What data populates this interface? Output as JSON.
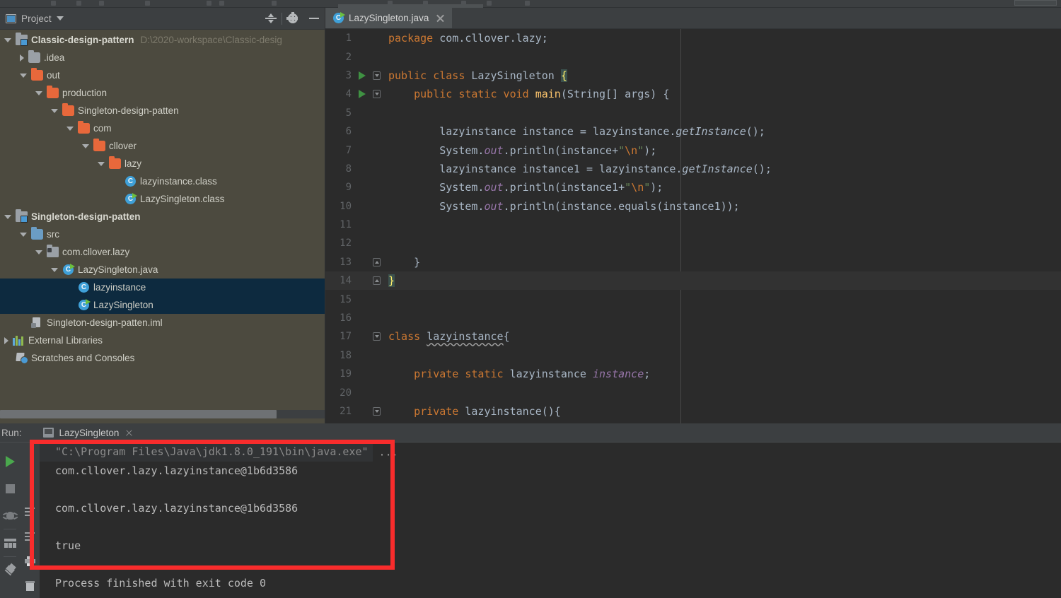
{
  "window": {
    "theme": "IntelliJ IDEA Darcula",
    "colors": {
      "editor_bg": "#2b2b2b",
      "panel_bg": "#3c3f41",
      "project_bg": "#4c4a3f",
      "selection": "#0d2a3f",
      "keyword": "#cc7832",
      "string": "#6a8759",
      "field": "#9876aa",
      "method": "#ffc66d",
      "default_text": "#a9b7c6",
      "annotation_red": "#f82c2c"
    }
  },
  "project_panel": {
    "title": "Project",
    "icons": {
      "panel_icon": "project-window-icon",
      "dropdown": "chevron-down-icon",
      "collapse_all": "collapse-all-icon",
      "settings": "gear-icon",
      "hide": "minimize-icon"
    },
    "tree": [
      {
        "id": "classic-design-pattern",
        "label": "Classic-design-pattern",
        "path": "D:\\2020-workspace\\Classic-desig",
        "depth": 0,
        "arrow": "open",
        "icon": "module-icon",
        "bold": true,
        "selected": false
      },
      {
        "id": "idea",
        "label": ".idea",
        "path": "",
        "depth": 1,
        "arrow": "closed",
        "icon": "folder-gray-icon",
        "bold": false,
        "selected": false
      },
      {
        "id": "out",
        "label": "out",
        "path": "",
        "depth": 1,
        "arrow": "open",
        "icon": "folder-orange-icon",
        "bold": false,
        "selected": false
      },
      {
        "id": "production",
        "label": "production",
        "path": "",
        "depth": 2,
        "arrow": "open",
        "icon": "folder-orange-icon",
        "bold": false,
        "selected": false
      },
      {
        "id": "singleton-design-patten-out",
        "label": "Singleton-design-patten",
        "path": "",
        "depth": 3,
        "arrow": "open",
        "icon": "folder-orange-icon",
        "bold": false,
        "selected": false
      },
      {
        "id": "com",
        "label": "com",
        "path": "",
        "depth": 4,
        "arrow": "open",
        "icon": "folder-orange-icon",
        "bold": false,
        "selected": false
      },
      {
        "id": "cllover",
        "label": "cllover",
        "path": "",
        "depth": 5,
        "arrow": "open",
        "icon": "folder-orange-icon",
        "bold": false,
        "selected": false
      },
      {
        "id": "lazy",
        "label": "lazy",
        "path": "",
        "depth": 6,
        "arrow": "open",
        "icon": "folder-orange-icon",
        "bold": false,
        "selected": false
      },
      {
        "id": "lazyinstance-class",
        "label": "lazyinstance.class",
        "path": "",
        "depth": 7,
        "arrow": "none",
        "icon": "java-class-icon",
        "bold": false,
        "selected": false
      },
      {
        "id": "lazysingleton-class",
        "label": "LazySingleton.class",
        "path": "",
        "depth": 7,
        "arrow": "none",
        "icon": "java-class-runnable-icon",
        "bold": false,
        "selected": false
      },
      {
        "id": "singleton-design-patten",
        "label": "Singleton-design-patten",
        "path": "",
        "depth": 0,
        "arrow": "open",
        "icon": "module-icon",
        "bold": true,
        "selected": false
      },
      {
        "id": "src",
        "label": "src",
        "path": "",
        "depth": 1,
        "arrow": "open",
        "icon": "folder-blue-icon",
        "bold": false,
        "selected": false
      },
      {
        "id": "com-cllover-lazy",
        "label": "com.cllover.lazy",
        "path": "",
        "depth": 2,
        "arrow": "open",
        "icon": "package-icon",
        "bold": false,
        "selected": false
      },
      {
        "id": "lazysingleton-java",
        "label": "LazySingleton.java",
        "path": "",
        "depth": 3,
        "arrow": "open",
        "icon": "java-class-runnable-icon",
        "bold": false,
        "selected": false
      },
      {
        "id": "lazyinstance-node",
        "label": "lazyinstance",
        "path": "",
        "depth": 4,
        "arrow": "none",
        "icon": "java-class-icon",
        "bold": false,
        "selected": true
      },
      {
        "id": "lazysingleton-node",
        "label": "LazySingleton",
        "path": "",
        "depth": 4,
        "arrow": "none",
        "icon": "java-class-runnable-icon",
        "bold": false,
        "selected": true
      },
      {
        "id": "iml",
        "label": "Singleton-design-patten.iml",
        "path": "",
        "depth": 1,
        "arrow": "none",
        "icon": "iml-file-icon",
        "bold": false,
        "selected": false
      },
      {
        "id": "external-libraries",
        "label": "External Libraries",
        "path": "",
        "depth": 0,
        "arrow": "closed",
        "icon": "libraries-icon",
        "bold": false,
        "selected": false
      },
      {
        "id": "scratches",
        "label": "Scratches and Consoles",
        "path": "",
        "depth": 0,
        "arrow": "none",
        "icon": "scratches-icon",
        "bold": false,
        "selected": false
      }
    ]
  },
  "editor": {
    "tab": {
      "name": "LazySingleton.java",
      "icon": "java-class-runnable-icon",
      "close": "close-icon",
      "active": true
    },
    "caret_line": 14,
    "lines": [
      {
        "n": 1,
        "run": false,
        "fold": "",
        "indent": 0,
        "tokens": [
          {
            "t": "package",
            "c": "kw"
          },
          {
            "t": " com.cllover.lazy;",
            "c": ""
          }
        ]
      },
      {
        "n": 2,
        "run": false,
        "fold": "",
        "indent": 0,
        "tokens": []
      },
      {
        "n": 3,
        "run": true,
        "fold": "start",
        "indent": 0,
        "tokens": [
          {
            "t": "public class",
            "c": "kw"
          },
          {
            "t": " LazySingleton ",
            "c": ""
          },
          {
            "t": "{",
            "c": "brace"
          }
        ]
      },
      {
        "n": 4,
        "run": true,
        "fold": "start",
        "indent": 1,
        "tokens": [
          {
            "t": "public static void",
            "c": "kw"
          },
          {
            "t": " ",
            "c": ""
          },
          {
            "t": "main",
            "c": "fn"
          },
          {
            "t": "(String[] args) {",
            "c": ""
          }
        ]
      },
      {
        "n": 5,
        "run": false,
        "fold": "",
        "indent": 1,
        "tokens": []
      },
      {
        "n": 6,
        "run": false,
        "fold": "",
        "indent": 2,
        "tokens": [
          {
            "t": "lazyinstance instance = lazyinstance.",
            "c": ""
          },
          {
            "t": "getInstance",
            "c": "it"
          },
          {
            "t": "();",
            "c": ""
          }
        ]
      },
      {
        "n": 7,
        "run": false,
        "fold": "",
        "indent": 2,
        "tokens": [
          {
            "t": "System.",
            "c": ""
          },
          {
            "t": "out",
            "c": "fld"
          },
          {
            "t": ".println(instance+",
            "c": ""
          },
          {
            "t": "\"",
            "c": "str"
          },
          {
            "t": "\\n",
            "c": "esc"
          },
          {
            "t": "\"",
            "c": "str"
          },
          {
            "t": ");",
            "c": ""
          }
        ]
      },
      {
        "n": 8,
        "run": false,
        "fold": "",
        "indent": 2,
        "tokens": [
          {
            "t": "lazyinstance instance1 = lazyinstance.",
            "c": ""
          },
          {
            "t": "getInstance",
            "c": "it"
          },
          {
            "t": "();",
            "c": ""
          }
        ]
      },
      {
        "n": 9,
        "run": false,
        "fold": "",
        "indent": 2,
        "tokens": [
          {
            "t": "System.",
            "c": ""
          },
          {
            "t": "out",
            "c": "fld"
          },
          {
            "t": ".println(instance1+",
            "c": ""
          },
          {
            "t": "\"",
            "c": "str"
          },
          {
            "t": "\\n",
            "c": "esc"
          },
          {
            "t": "\"",
            "c": "str"
          },
          {
            "t": ");",
            "c": ""
          }
        ]
      },
      {
        "n": 10,
        "run": false,
        "fold": "",
        "indent": 2,
        "tokens": [
          {
            "t": "System.",
            "c": ""
          },
          {
            "t": "out",
            "c": "fld"
          },
          {
            "t": ".println(instance.equals(instance1));",
            "c": ""
          }
        ]
      },
      {
        "n": 11,
        "run": false,
        "fold": "",
        "indent": 0,
        "tokens": []
      },
      {
        "n": 12,
        "run": false,
        "fold": "",
        "indent": 0,
        "tokens": []
      },
      {
        "n": 13,
        "run": false,
        "fold": "end",
        "indent": 1,
        "tokens": [
          {
            "t": "}",
            "c": ""
          }
        ]
      },
      {
        "n": 14,
        "run": false,
        "fold": "end",
        "indent": 0,
        "tokens": [
          {
            "t": "}",
            "c": "brace"
          }
        ]
      },
      {
        "n": 15,
        "run": false,
        "fold": "",
        "indent": 0,
        "tokens": []
      },
      {
        "n": 16,
        "run": false,
        "fold": "",
        "indent": 0,
        "tokens": []
      },
      {
        "n": 17,
        "run": false,
        "fold": "start",
        "indent": 0,
        "tokens": [
          {
            "t": "class",
            "c": "kw"
          },
          {
            "t": " ",
            "c": ""
          },
          {
            "t": "lazyinstance",
            "c": "sq"
          },
          {
            "t": "{",
            "c": ""
          }
        ]
      },
      {
        "n": 18,
        "run": false,
        "fold": "",
        "indent": 0,
        "tokens": []
      },
      {
        "n": 19,
        "run": false,
        "fold": "",
        "indent": 1,
        "tokens": [
          {
            "t": "private static",
            "c": "kw"
          },
          {
            "t": " lazyinstance ",
            "c": ""
          },
          {
            "t": "instance",
            "c": "fld"
          },
          {
            "t": ";",
            "c": ""
          }
        ]
      },
      {
        "n": 20,
        "run": false,
        "fold": "",
        "indent": 0,
        "tokens": []
      },
      {
        "n": 21,
        "run": false,
        "fold": "start",
        "indent": 1,
        "tokens": [
          {
            "t": "private",
            "c": "kw"
          },
          {
            "t": " lazyinstance(){",
            "c": ""
          }
        ]
      }
    ]
  },
  "run_panel": {
    "label": "Run:",
    "tab": {
      "name": "LazySingleton",
      "icon": "run-config-icon",
      "close": "close-icon"
    },
    "toolbar": [
      {
        "id": "rerun",
        "name": "rerun-button",
        "icon": "play-icon"
      },
      {
        "id": "stop",
        "name": "stop-button",
        "icon": "stop-icon"
      },
      {
        "id": "debug",
        "name": "debug-button",
        "icon": "bug-icon"
      },
      {
        "id": "layout",
        "name": "restore-layout-button",
        "icon": "grid-icon"
      },
      {
        "id": "pin",
        "name": "pin-tab-button",
        "icon": "pin-icon"
      }
    ],
    "toolbar2": [
      {
        "id": "soft-wrap",
        "name": "soft-wrap-button",
        "icon": "lines-icon"
      },
      {
        "id": "scroll-end",
        "name": "scroll-to-end-button",
        "icon": "lines-icon"
      },
      {
        "id": "print",
        "name": "print-button",
        "icon": "printer-icon"
      },
      {
        "id": "clear",
        "name": "clear-all-button",
        "icon": "trash-icon"
      }
    ],
    "console": {
      "command": "\"C:\\Program Files\\Java\\jdk1.8.0_191\\bin\\java.exe\"",
      "command_ellipsis": "...",
      "output": [
        "com.cllover.lazy.lazyinstance@1b6d3586",
        "",
        "com.cllover.lazy.lazyinstance@1b6d3586",
        "",
        "true",
        "",
        "Process finished with exit code 0"
      ]
    }
  },
  "annotation": {
    "name": "red-highlight-rectangle",
    "color": "#f82c2c",
    "encloses": "console output lines"
  }
}
